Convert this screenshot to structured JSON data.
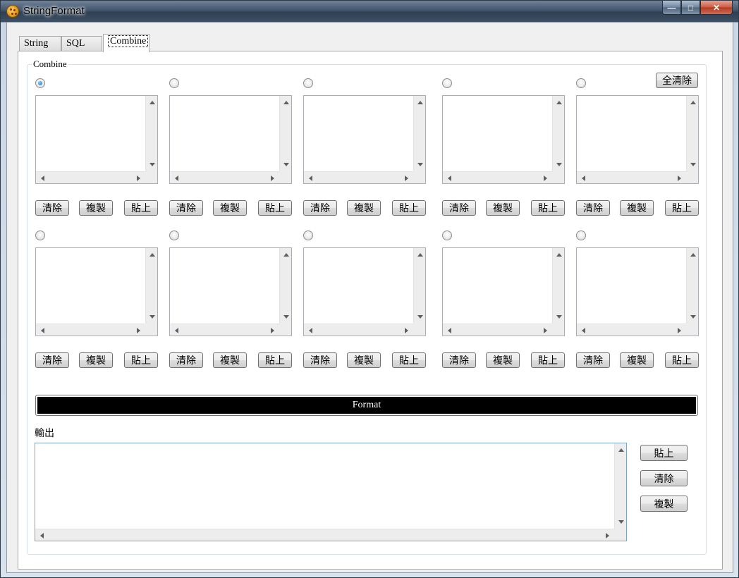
{
  "window": {
    "title": "StringFormat"
  },
  "tabs": [
    {
      "label": "String",
      "active": false
    },
    {
      "label": "SQL",
      "active": false
    },
    {
      "label": "Combine",
      "active": true
    }
  ],
  "group": {
    "title": "Combine",
    "clear_all_label": "全清除",
    "slot_buttons": {
      "clear": "清除",
      "copy": "複製",
      "paste": "貼上"
    },
    "slots": [
      {
        "row": 0,
        "col": 0,
        "selected": true,
        "value": ""
      },
      {
        "row": 0,
        "col": 1,
        "selected": false,
        "value": ""
      },
      {
        "row": 0,
        "col": 2,
        "selected": false,
        "value": ""
      },
      {
        "row": 0,
        "col": 3,
        "selected": false,
        "value": ""
      },
      {
        "row": 0,
        "col": 4,
        "selected": false,
        "value": ""
      },
      {
        "row": 1,
        "col": 0,
        "selected": false,
        "value": ""
      },
      {
        "row": 1,
        "col": 1,
        "selected": false,
        "value": ""
      },
      {
        "row": 1,
        "col": 2,
        "selected": false,
        "value": ""
      },
      {
        "row": 1,
        "col": 3,
        "selected": false,
        "value": ""
      },
      {
        "row": 1,
        "col": 4,
        "selected": false,
        "value": ""
      }
    ],
    "format_label": "Format",
    "output": {
      "label": "輸出",
      "value": "",
      "paste_label": "貼上",
      "clear_label": "清除",
      "copy_label": "複製"
    }
  },
  "colors": {
    "format_bar": "#000000",
    "radio_selected": "#1769b2"
  }
}
